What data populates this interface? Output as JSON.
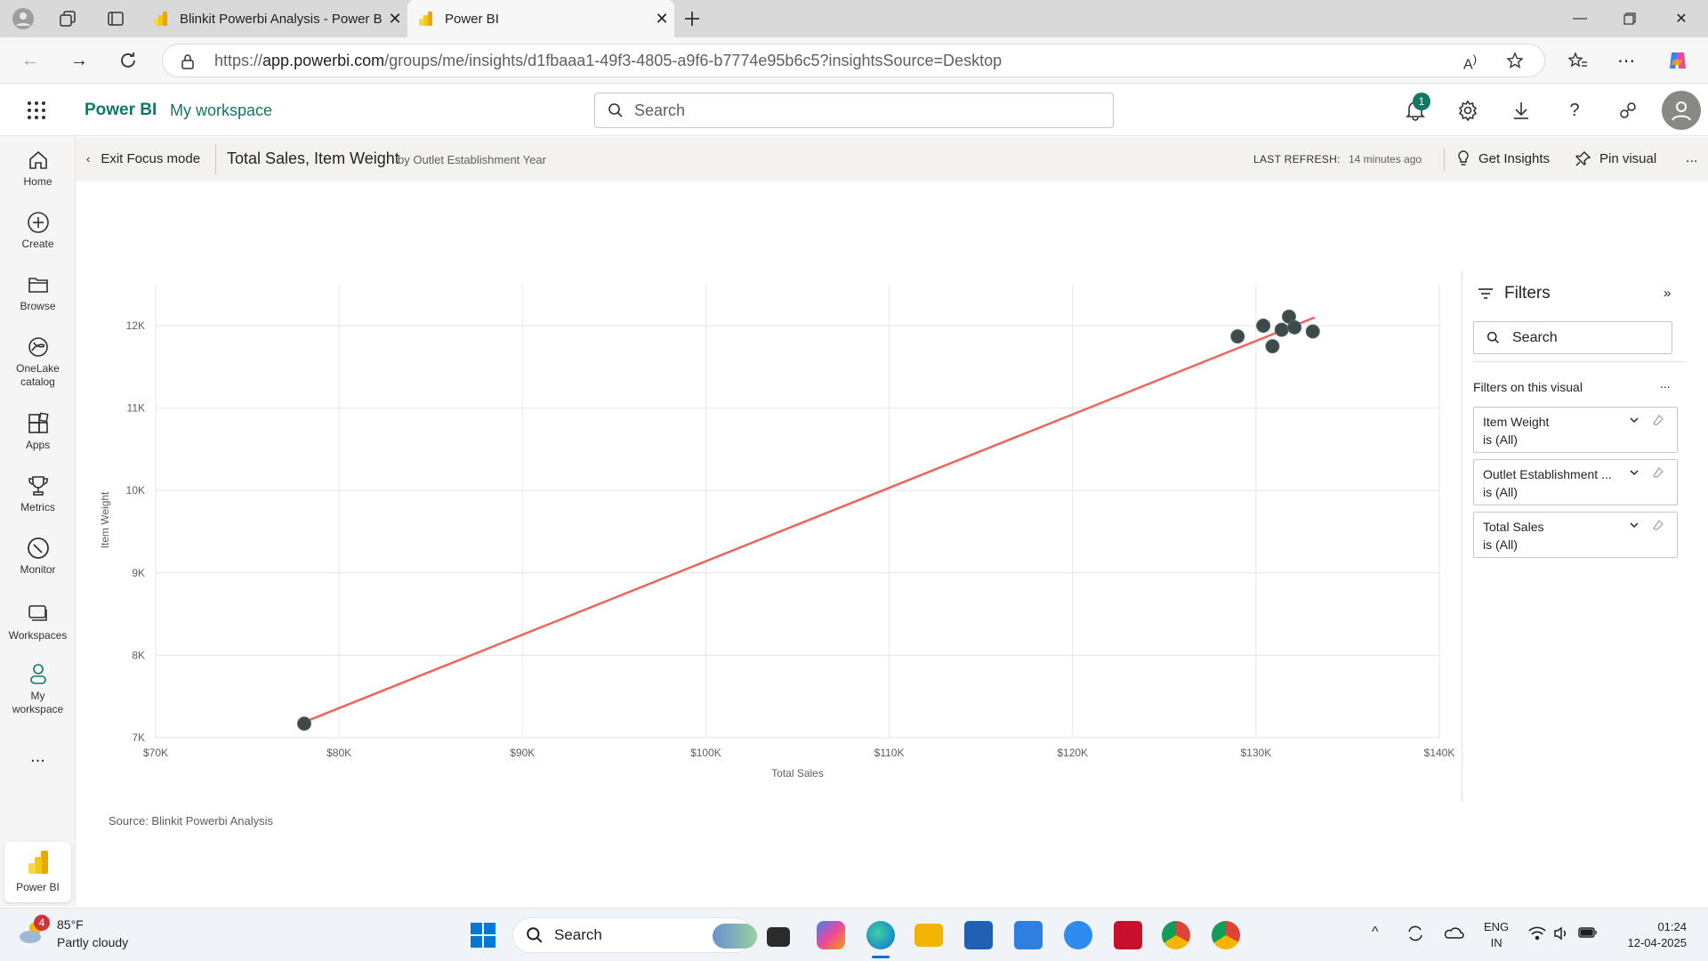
{
  "browser": {
    "tabs": [
      {
        "title": "Blinkit Powerbi Analysis - Power B",
        "active": false
      },
      {
        "title": "Power BI",
        "active": true
      }
    ],
    "url_prefix": "https://",
    "url_host": "app.powerbi.com",
    "url_path": "/groups/me/insights/d1fbaaa1-49f3-4805-a9f6-b7774e95b6c5?insightsSource=Desktop"
  },
  "header": {
    "app_name": "Power BI",
    "workspace": "My workspace",
    "search_placeholder": "Search",
    "notification_count": "1"
  },
  "leftnav": {
    "items": [
      {
        "label": "Home",
        "icon": "home-icon"
      },
      {
        "label": "Create",
        "icon": "plus-circle-icon"
      },
      {
        "label": "Browse",
        "icon": "folder-icon"
      },
      {
        "label": "OneLake catalog",
        "icon": "onelake-icon"
      },
      {
        "label": "Apps",
        "icon": "apps-icon"
      },
      {
        "label": "Metrics",
        "icon": "trophy-icon"
      },
      {
        "label": "Monitor",
        "icon": "monitor-icon"
      },
      {
        "label": "Workspaces",
        "icon": "workspaces-icon"
      },
      {
        "label": "My workspace",
        "icon": "person-icon"
      }
    ],
    "more": "...",
    "pinned_app": "Power BI"
  },
  "focusbar": {
    "exit_label": "Exit Focus mode",
    "visual_title": "Total Sales, Item Weight",
    "visual_subtitle": "by Outlet Establishment Year",
    "refresh_label": "LAST REFRESH:",
    "refresh_value": "14 minutes ago",
    "get_insights": "Get Insights",
    "pin_visual": "Pin visual",
    "more": "..."
  },
  "chart_data": {
    "type": "scatter",
    "xlabel": "Total Sales",
    "ylabel": "Item Weight",
    "xlim": [
      70000,
      140000
    ],
    "ylim": [
      7000,
      12500
    ],
    "x_ticks": [
      "$70K",
      "$80K",
      "$90K",
      "$100K",
      "$110K",
      "$120K",
      "$130K",
      "$140K"
    ],
    "y_ticks": [
      "7K",
      "8K",
      "9K",
      "10K",
      "11K",
      "12K"
    ],
    "points": [
      {
        "x": 78100,
        "y": 7170
      },
      {
        "x": 129000,
        "y": 11870
      },
      {
        "x": 130400,
        "y": 12000
      },
      {
        "x": 130900,
        "y": 11750
      },
      {
        "x": 131400,
        "y": 11950
      },
      {
        "x": 131800,
        "y": 12110
      },
      {
        "x": 132100,
        "y": 11980
      },
      {
        "x": 133100,
        "y": 11930
      }
    ],
    "trend_line": {
      "x1": 78000,
      "y1": 7180,
      "x2": 133200,
      "y2": 12100
    },
    "point_color": "#3c4a4a",
    "trend_color": "#f0625c",
    "grid": true
  },
  "source": "Source: Blinkit Powerbi Analysis",
  "filters": {
    "title": "Filters",
    "search_placeholder": "Search",
    "section": "Filters on this visual",
    "more": "...",
    "cards": [
      {
        "name": "Item Weight",
        "state": "is (All)"
      },
      {
        "name": "Outlet Establishment ...",
        "state": "is (All)"
      },
      {
        "name": "Total Sales",
        "state": "is (All)"
      }
    ]
  },
  "taskbar": {
    "weather_temp": "85°F",
    "weather_desc": "Partly cloudy",
    "weather_badge": "4",
    "search_placeholder": "Search",
    "lang_line1": "ENG",
    "lang_line2": "IN",
    "time": "01:24",
    "date": "12-04-2025"
  }
}
